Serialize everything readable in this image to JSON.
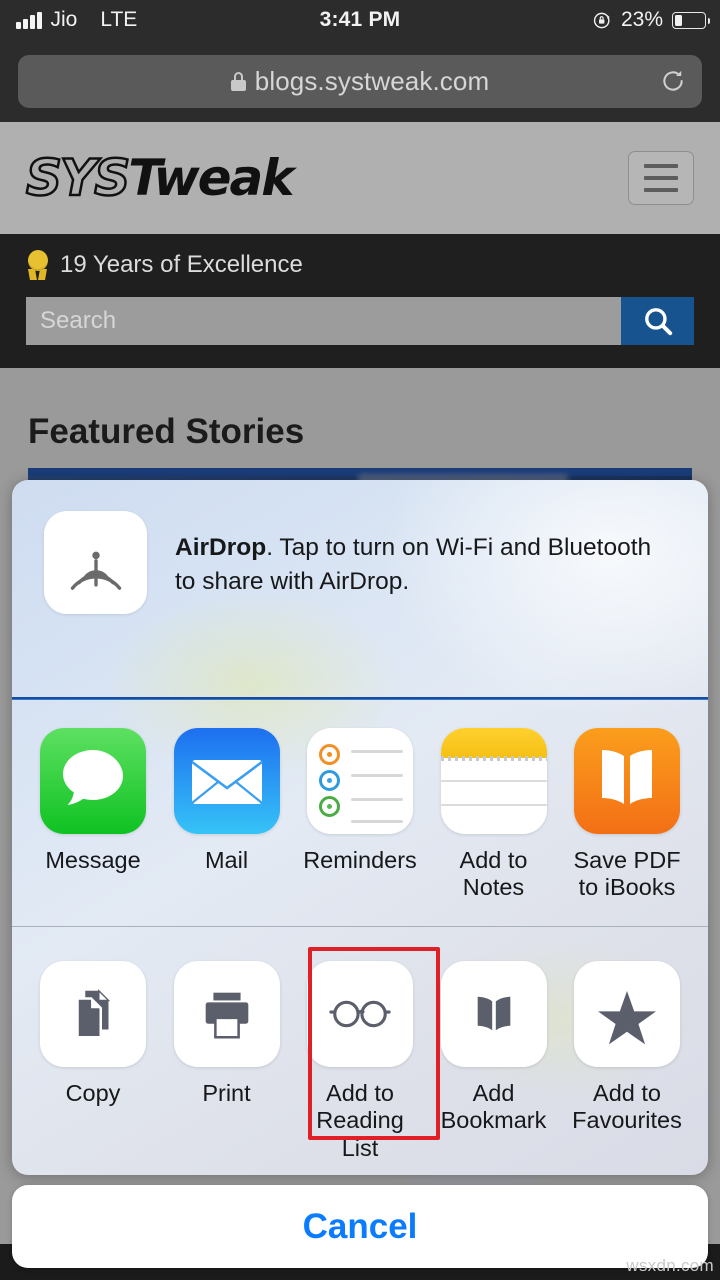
{
  "status_bar": {
    "carrier": "Jio",
    "network": "LTE",
    "time": "3:41 PM",
    "battery_percent": "23%",
    "battery_level": 25,
    "rotation_lock_icon": "rotation-lock-icon",
    "signal_icon": "signal-bars-icon",
    "battery_icon": "battery-icon"
  },
  "browser": {
    "url": "blogs.systweak.com",
    "lock_icon": "lock-icon",
    "reload_icon": "reload-icon"
  },
  "site_header": {
    "logo_part1": "SYS",
    "logo_part2": "Tweak",
    "menu_icon": "hamburger-menu-icon"
  },
  "promo_bar": {
    "medal_icon": "medal-icon",
    "tagline": "19 Years of Excellence"
  },
  "search": {
    "placeholder": "Search",
    "value": "",
    "button_icon": "search-icon",
    "button_color": "#17538f"
  },
  "page": {
    "section_title": "Featured Stories"
  },
  "share_sheet": {
    "airdrop": {
      "icon": "airdrop-icon",
      "title": "AirDrop",
      "text": "AirDrop. Tap to turn on Wi-Fi and Bluetooth to share with AirDrop."
    },
    "apps": [
      {
        "label": "Message",
        "icon": "messages-app-icon"
      },
      {
        "label": "Mail",
        "icon": "mail-app-icon"
      },
      {
        "label": "Reminders",
        "icon": "reminders-app-icon"
      },
      {
        "label": "Add to Notes",
        "icon": "notes-app-icon"
      },
      {
        "label": "Save PDF\nto iBooks",
        "icon": "ibooks-app-icon"
      }
    ],
    "actions": [
      {
        "label": "Copy",
        "icon": "copy-icon",
        "highlighted": false
      },
      {
        "label": "Print",
        "icon": "printer-icon",
        "highlighted": false
      },
      {
        "label": "Add to\nReading List",
        "icon": "glasses-icon",
        "highlighted": true
      },
      {
        "label": "Add\nBookmark",
        "icon": "open-book-icon",
        "highlighted": false
      },
      {
        "label": "Add to\nFavourites",
        "icon": "star-icon",
        "highlighted": false
      }
    ],
    "cancel_label": "Cancel",
    "cancel_color": "#0a7cff",
    "highlight_color": "#e02027"
  },
  "watermark": "wsxdn.com"
}
